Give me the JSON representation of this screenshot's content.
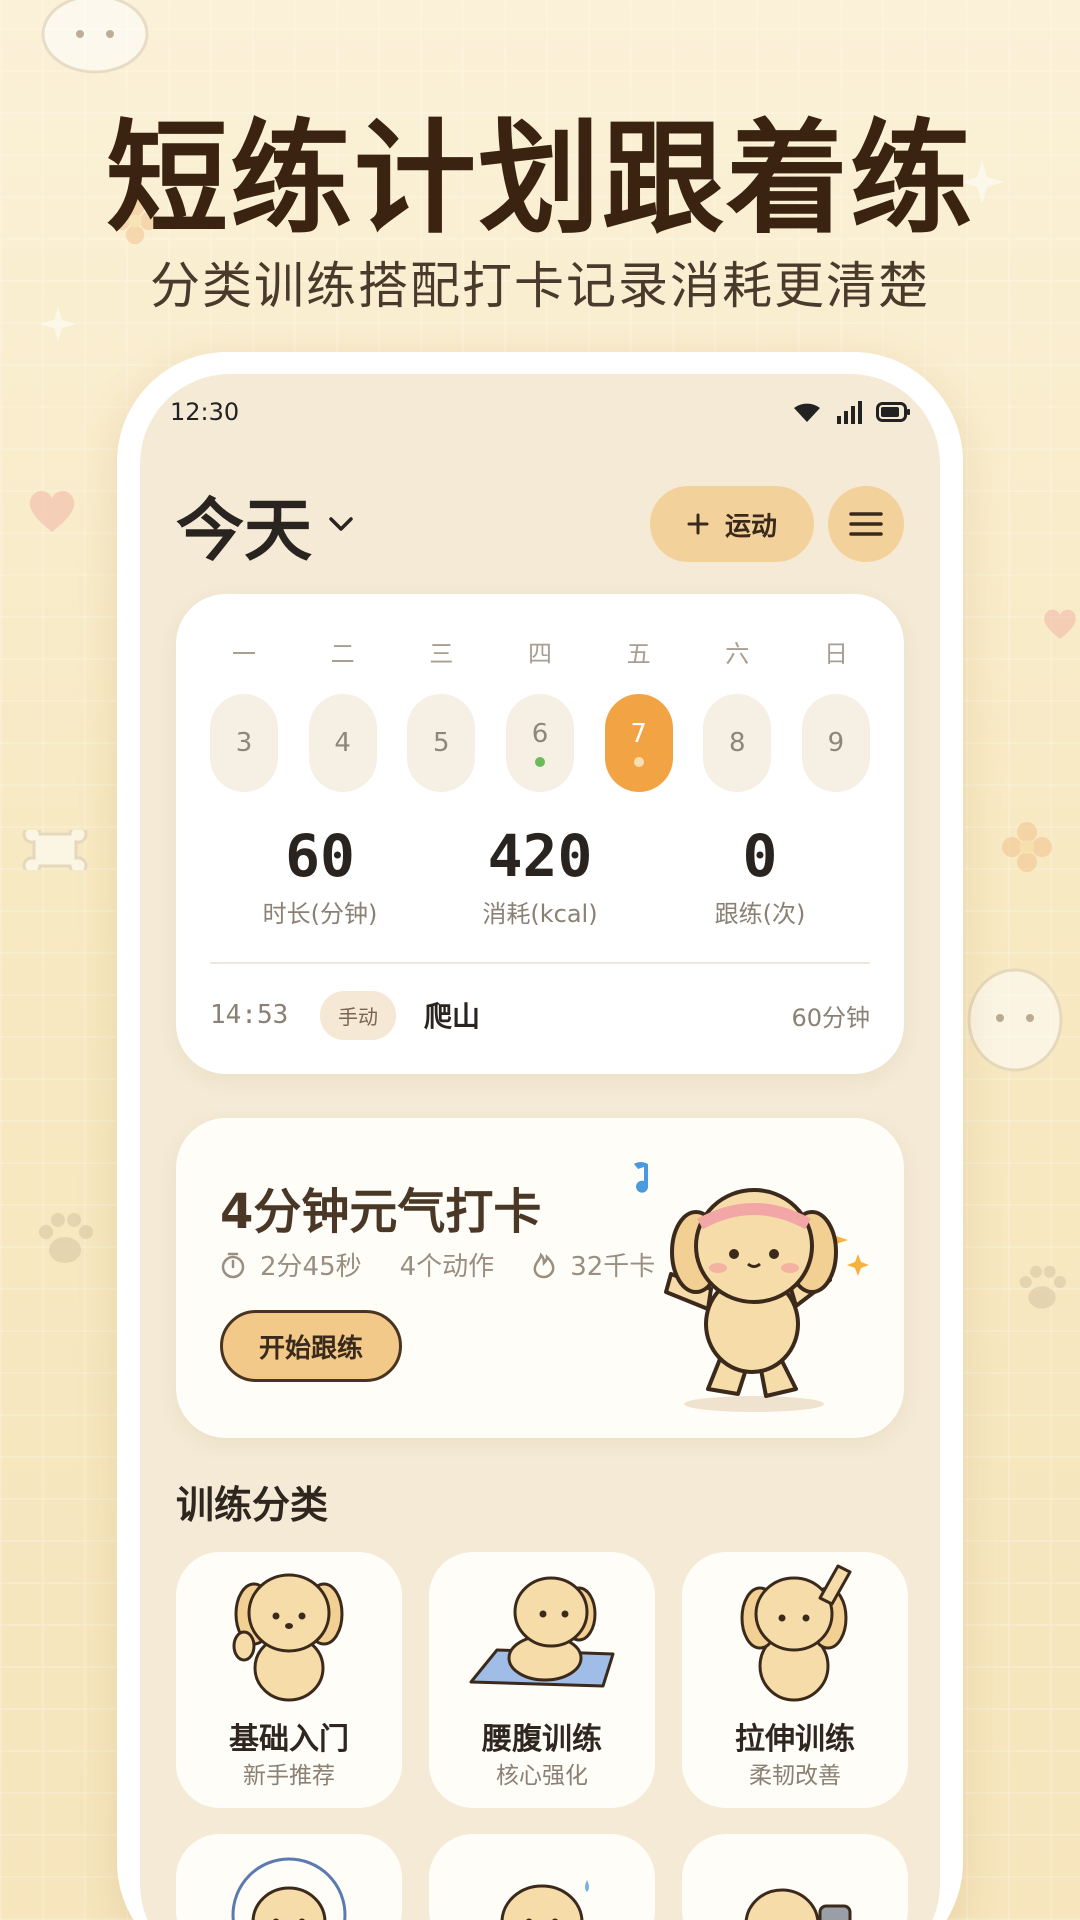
{
  "hero": {
    "title": "短练计划跟着练",
    "subtitle": "分类训练搭配打卡记录消耗更清楚"
  },
  "status_bar": {
    "time": "12:30",
    "icons": [
      "wifi-icon",
      "signal-icon",
      "battery-icon"
    ]
  },
  "header": {
    "title": "今天",
    "add_button_label": "运动",
    "icons": [
      "chevron-down-icon",
      "plus-icon",
      "menu-icon"
    ]
  },
  "week": {
    "labels": [
      "一",
      "二",
      "三",
      "四",
      "五",
      "六",
      "日"
    ],
    "days": [
      {
        "num": "3",
        "dot": null
      },
      {
        "num": "4",
        "dot": null
      },
      {
        "num": "5",
        "dot": null
      },
      {
        "num": "6",
        "dot": "#6cba5c"
      },
      {
        "num": "7",
        "dot": "#f6dfb3",
        "active": true
      },
      {
        "num": "8",
        "dot": null
      },
      {
        "num": "9",
        "dot": null
      }
    ]
  },
  "stats": [
    {
      "value": "60",
      "label": "时长(分钟)"
    },
    {
      "value": "420",
      "label": "消耗(kcal)"
    },
    {
      "value": "0",
      "label": "跟练(次)"
    }
  ],
  "log": {
    "time": "14:53",
    "tag": "手动",
    "name": "爬山",
    "duration": "60分钟"
  },
  "promo": {
    "title": "4分钟元气打卡",
    "duration": "2分45秒",
    "moves": "4个动作",
    "kcal": "32千卡",
    "start_label": "开始跟练"
  },
  "categories_title": "训练分类",
  "categories": [
    {
      "title": "基础入门",
      "sub": "新手推荐"
    },
    {
      "title": "腰腹训练",
      "sub": "核心强化"
    },
    {
      "title": "拉伸训练",
      "sub": "柔韧改善"
    }
  ],
  "colors": {
    "accent": "#f2a445",
    "button": "#f3d19b",
    "background": "#f4ead6"
  }
}
